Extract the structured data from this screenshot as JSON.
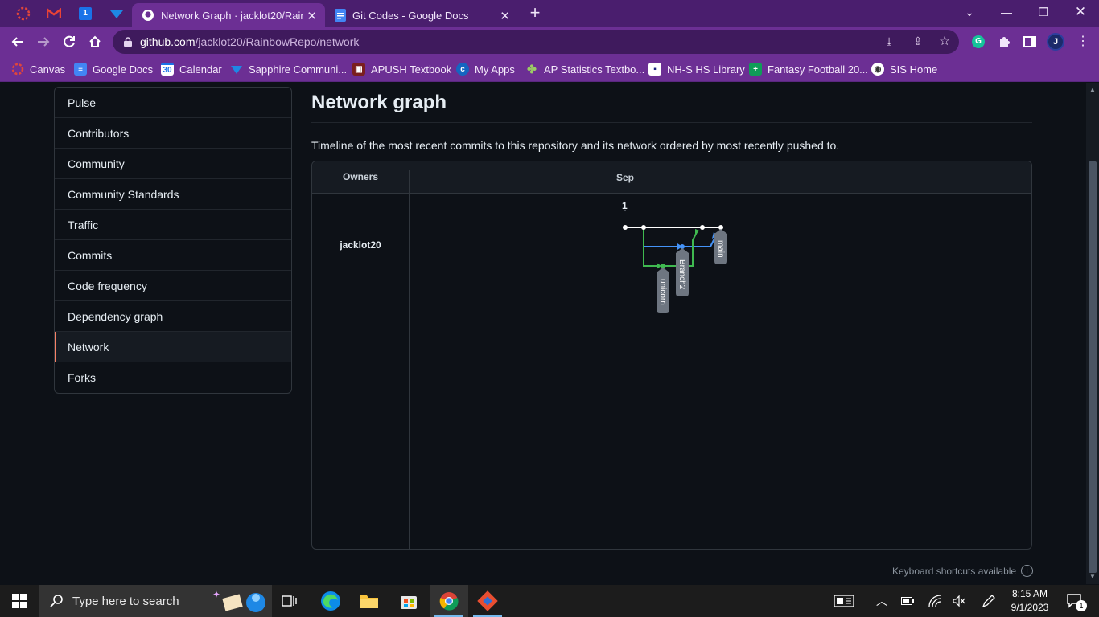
{
  "browser": {
    "tabs": [
      {
        "title": "Network Graph · jacklot20/RainbowRepo",
        "active": true
      },
      {
        "title": "Git Codes - Google Docs",
        "active": false
      }
    ],
    "url_host": "github.com",
    "url_path": "/jacklot20/RainbowRepo/network",
    "profile_initial": "J"
  },
  "bookmarks": [
    {
      "label": "Canvas",
      "icon": "canvas-icon"
    },
    {
      "label": "Google Docs",
      "icon": "google-docs-icon"
    },
    {
      "label": "Calendar",
      "icon": "calendar-icon",
      "icon_text": "30"
    },
    {
      "label": "Sapphire Communi...",
      "icon": "sapphire-icon"
    },
    {
      "label": "APUSH Textbook",
      "icon": "apush-icon"
    },
    {
      "label": "My Apps",
      "icon": "my-apps-icon"
    },
    {
      "label": "AP Statistics Textbo...",
      "icon": "ap-statistics-icon"
    },
    {
      "label": "NH-S HS Library",
      "icon": "library-icon"
    },
    {
      "label": "Fantasy Football 20...",
      "icon": "fantasy-football-icon"
    },
    {
      "label": "SIS Home",
      "icon": "sis-home-icon"
    }
  ],
  "sidebar": {
    "items": [
      {
        "label": "Pulse"
      },
      {
        "label": "Contributors"
      },
      {
        "label": "Community"
      },
      {
        "label": "Community Standards"
      },
      {
        "label": "Traffic"
      },
      {
        "label": "Commits"
      },
      {
        "label": "Code frequency"
      },
      {
        "label": "Dependency graph"
      },
      {
        "label": "Network",
        "selected": true
      },
      {
        "label": "Forks"
      }
    ]
  },
  "main": {
    "title": "Network graph",
    "description": "Timeline of the most recent commits to this repository and its network ordered by most recently pushed to.",
    "graph": {
      "owners_header": "Owners",
      "month": "Sep",
      "day": "1",
      "owner": "jacklot20",
      "branches": [
        {
          "name": "main",
          "color": "#ffffff"
        },
        {
          "name": "Branch2",
          "color": "#4493f8"
        },
        {
          "name": "unicorn",
          "color": "#3fb950"
        }
      ]
    },
    "shortcuts_text": "Keyboard shortcuts available"
  },
  "taskbar": {
    "search_placeholder": "Type here to search",
    "time": "8:15 AM",
    "date": "9/1/2023",
    "notification_count": "1"
  },
  "colors": {
    "chrome_frame": "#4a1e6e",
    "chrome_toolbar": "#6c2f94",
    "github_bg": "#0d1117",
    "selected_accent": "#f78166"
  }
}
